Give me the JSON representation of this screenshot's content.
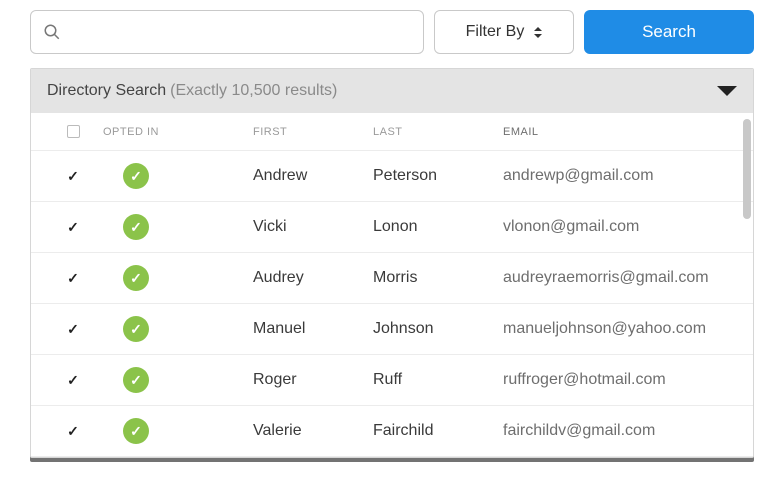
{
  "toolbar": {
    "search_placeholder": "",
    "filter_label": "Filter By",
    "search_button": "Search"
  },
  "panel": {
    "title": "Directory Search",
    "count_text": "(Exactly 10,500 results)"
  },
  "columns": {
    "opted": "OPTED IN",
    "first": "FIRST",
    "last": "LAST",
    "email": "EMAIL"
  },
  "rows": [
    {
      "checked": true,
      "opted": true,
      "first": "Andrew",
      "last": "Peterson",
      "email": "andrewp@gmail.com"
    },
    {
      "checked": true,
      "opted": true,
      "first": "Vicki",
      "last": "Lonon",
      "email": "vlonon@gmail.com"
    },
    {
      "checked": true,
      "opted": true,
      "first": "Audrey",
      "last": "Morris",
      "email": "audreyraemorris@gmail.com"
    },
    {
      "checked": true,
      "opted": true,
      "first": "Manuel",
      "last": "Johnson",
      "email": "manueljohnson@yahoo.com"
    },
    {
      "checked": true,
      "opted": true,
      "first": "Roger",
      "last": "Ruff",
      "email": "ruffroger@hotmail.com"
    },
    {
      "checked": true,
      "opted": true,
      "first": "Valerie",
      "last": "Fairchild",
      "email": "fairchildv@gmail.com"
    }
  ],
  "colors": {
    "accent": "#1f8ce6",
    "opted_badge": "#8bc34a"
  }
}
